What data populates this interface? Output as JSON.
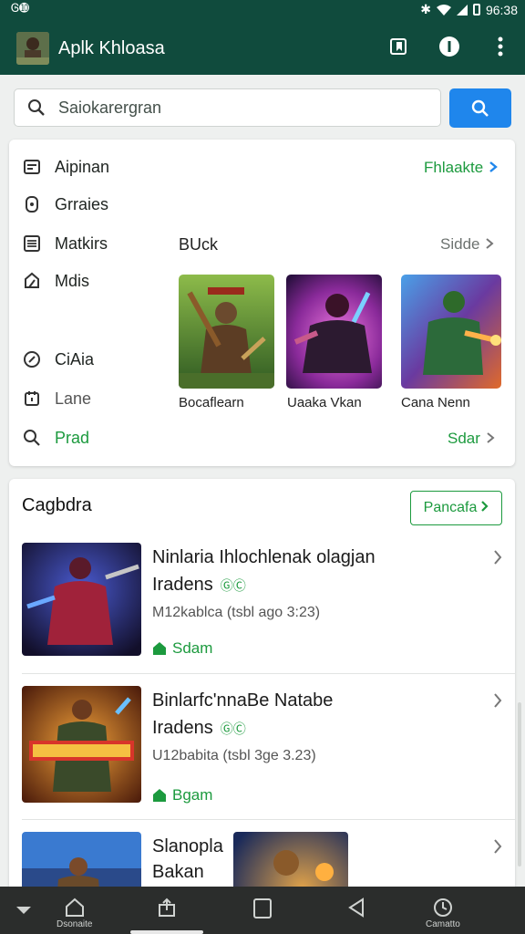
{
  "status_bar": {
    "left_text": "Ꮆ➓",
    "time": "96:38"
  },
  "app_bar": {
    "title": "Aplk Khloasa",
    "actions": [
      {
        "icon": "bookmark-icon"
      },
      {
        "icon": "info-icon"
      },
      {
        "icon": "more-vert-icon"
      }
    ]
  },
  "search": {
    "placeholder": "Saiokarergran",
    "button_icon": "search-icon"
  },
  "menu": {
    "items": [
      {
        "label": "Aipinan",
        "icon": "news-icon"
      },
      {
        "label": "Grraies",
        "icon": "controller-icon"
      },
      {
        "label": "Matkirs",
        "icon": "list-icon"
      },
      {
        "label": "Mdis",
        "icon": "puzzle-icon"
      },
      {
        "label": "CiAia",
        "icon": "badge-icon"
      },
      {
        "label": "Lane",
        "icon": "calendar-icon"
      },
      {
        "label": "Prad",
        "icon": "search-icon"
      }
    ],
    "top_link": "Fhlaakte",
    "section_title": "BUck",
    "section_link": "Sidde",
    "bottom_link": "Sdar",
    "tiles": [
      {
        "caption": "Bocaflearn"
      },
      {
        "caption": "Uaaka Vkan"
      },
      {
        "caption": "Cana Nenn"
      }
    ]
  },
  "list": {
    "title": "Cagbdra",
    "button_label": "Pancafa",
    "rows": [
      {
        "title": "Ninlaria Ihlochlenak olagjan",
        "title2": "Iradens",
        "mini": "ⒼⒸ",
        "sub": "M12kablca (tsbl ago 3:23)",
        "tag": "Sdam"
      },
      {
        "title": "Binlarfc'nnaBe Natabe",
        "title2": "Iradens",
        "mini": "ⒼⒸ",
        "sub": "U12babita (tsbl 3ge 3.23)",
        "tag": "Bgam"
      },
      {
        "title": "Slanopla",
        "title2": "Bakan"
      }
    ]
  },
  "bottom_nav": {
    "items": [
      {
        "label": "",
        "icon": "chevron-down-icon"
      },
      {
        "label": "Dsonaite",
        "icon": "home-icon"
      },
      {
        "label": "",
        "icon": "share-icon"
      },
      {
        "label": "",
        "icon": "square-icon"
      },
      {
        "label": "",
        "icon": "back-icon"
      },
      {
        "label": "Camatto",
        "icon": "clock-icon"
      }
    ]
  },
  "colors": {
    "app_bar": "#104b3d",
    "accent_green": "#1c9a3e",
    "search_button": "#1f86ec",
    "nav": "#2b2d2c"
  }
}
